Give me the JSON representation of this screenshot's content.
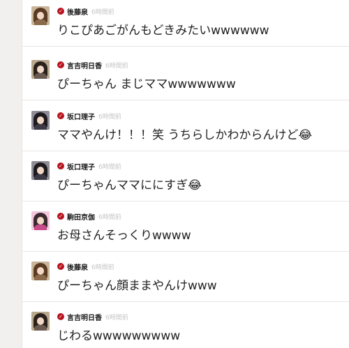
{
  "comments": [
    {
      "author": "後藤泉",
      "time": "6時間前",
      "text": "りこぴあごがんもどきみたいwwwwww",
      "avatar": {
        "hair": "#5b3a22",
        "body": "#8a6a4a",
        "bg": "#c9b59a"
      }
    },
    {
      "author": "言吉明日香",
      "time": "6時間前",
      "text": "ぴーちゃん まじママwwwwwww",
      "avatar": {
        "hair": "#2a211c",
        "body": "#6b5a50",
        "bg": "#b8a88e"
      }
    },
    {
      "author": "坂口理子",
      "time": "6時間前",
      "text": "ママやんけ！！！笑 うちらしかわからんけど😂",
      "avatar": {
        "hair": "#1c1a1f",
        "body": "#3c3a44",
        "bg": "#8f8c96"
      }
    },
    {
      "author": "坂口理子",
      "time": "6時間前",
      "text": "ぴーちゃんママににすぎ😂",
      "avatar": {
        "hair": "#1c1a1f",
        "body": "#3c3a44",
        "bg": "#8f8c96"
      }
    },
    {
      "author": "駒田京伽",
      "time": "6時間前",
      "text": "お母さんそっくりwwww",
      "avatar": {
        "hair": "#3a2a2f",
        "body": "#c84a8a",
        "bg": "#f2c7dc"
      }
    },
    {
      "author": "後藤泉",
      "time": "6時間前",
      "text": "ぴーちゃん顔ままやんけwww",
      "avatar": {
        "hair": "#5b3a22",
        "body": "#8a6a4a",
        "bg": "#c9b59a"
      }
    },
    {
      "author": "言吉明日香",
      "time": "6時間前",
      "text": "じわるwwwwwwwww",
      "avatar": {
        "hair": "#2a211c",
        "body": "#6b5a50",
        "bg": "#b8a88e"
      }
    }
  ],
  "badge_glyph": "✓",
  "colors": {
    "badge": "#b8141f",
    "time": "#c4c4c4",
    "text": "#222222"
  }
}
